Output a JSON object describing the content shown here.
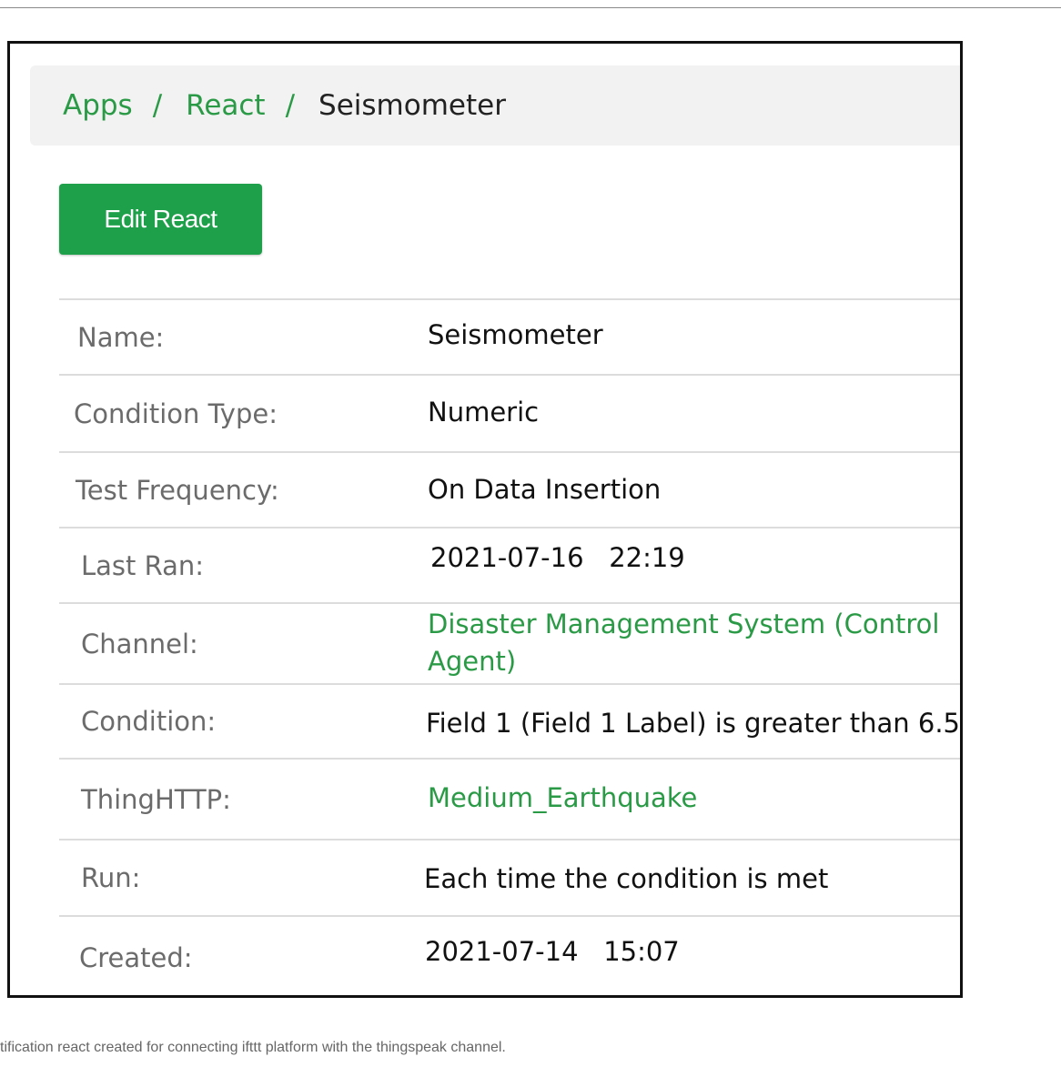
{
  "breadcrumb": {
    "items": [
      "Apps",
      "React"
    ],
    "separator": "/",
    "current": "Seismometer"
  },
  "actions": {
    "edit_label": "Edit React"
  },
  "details": [
    {
      "label": "Name:",
      "value": "Seismometer",
      "link": false
    },
    {
      "label": "Condition Type:",
      "value": "Numeric",
      "link": false
    },
    {
      "label": "Test Frequency:",
      "value": "On Data Insertion",
      "link": false
    },
    {
      "label": "Last Ran:",
      "value": "2021-07-16   22:19",
      "link": false
    },
    {
      "label": "Channel:",
      "value": "Disaster Management System (Control Agent)",
      "link": true
    },
    {
      "label": "Condition:",
      "value": "Field 1 (Field 1 Label) is greater than 6.5",
      "link": false
    },
    {
      "label": "ThingHTTP:",
      "value": "Medium_Earthquake",
      "link": true
    },
    {
      "label": "Run:",
      "value": "Each time the condition is met",
      "link": false
    },
    {
      "label": "Created:",
      "value": "2021-07-14   15:07",
      "link": false
    }
  ],
  "caption": "tification react created for connecting ifttt platform with the thingspeak channel.",
  "colors": {
    "accent": "#1ea04b",
    "link": "#2a9a46"
  }
}
